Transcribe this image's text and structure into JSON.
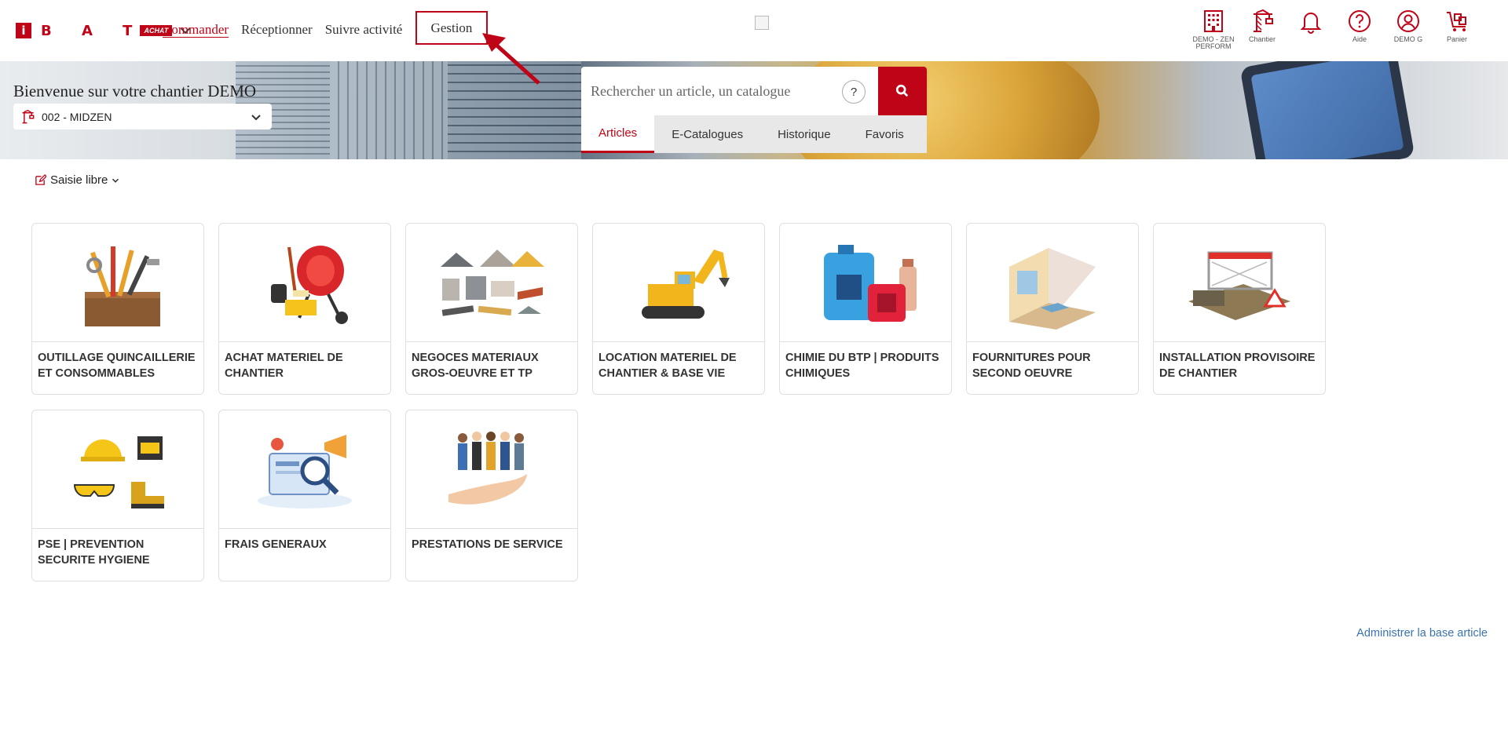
{
  "logo": {
    "letters": "B A T",
    "badge": "ACHAT",
    "i": "i"
  },
  "nav": {
    "items": [
      {
        "label": "Commander",
        "active": true
      },
      {
        "label": "Réceptionner"
      },
      {
        "label": "Suivre activité"
      }
    ],
    "highlighted": {
      "label": "Gestion"
    }
  },
  "header_icons": [
    {
      "icon": "building-icon",
      "label": "DEMO - ZEN PERFORM"
    },
    {
      "icon": "crane-icon",
      "label": "Chantier"
    },
    {
      "icon": "bell-icon",
      "label": ""
    },
    {
      "icon": "help-icon",
      "label": "Aide"
    },
    {
      "icon": "user-icon",
      "label": "DEMO G"
    },
    {
      "icon": "cart-icon",
      "label": "Panier"
    }
  ],
  "hero": {
    "welcome": "Bienvenue sur votre chantier DEMO",
    "chantier_value": "002 - MIDZEN"
  },
  "search": {
    "placeholder": "Rechercher un article, un catalogue",
    "help": "?",
    "tabs": [
      {
        "label": "Articles",
        "active": true
      },
      {
        "label": "E-Catalogues"
      },
      {
        "label": "Historique"
      },
      {
        "label": "Favoris"
      }
    ]
  },
  "saisie": {
    "label": "Saisie libre"
  },
  "categories": [
    {
      "title": "OUTILLAGE QUINCAILLERIE ET CONSOMMABLES",
      "icon": "toolbox-icon"
    },
    {
      "title": "ACHAT MATERIEL DE CHANTIER",
      "icon": "concrete-mixer-icon"
    },
    {
      "title": "NEGOCES MATERIAUX GROS-OEUVRE ET TP",
      "icon": "materials-icon"
    },
    {
      "title": "LOCATION MATERIEL DE CHANTIER & BASE VIE",
      "icon": "excavator-icon"
    },
    {
      "title": "CHIMIE DU BTP | PRODUITS CHIMIQUES",
      "icon": "chemical-cans-icon"
    },
    {
      "title": "FOURNITURES POUR SECOND OEUVRE",
      "icon": "room-renovation-icon"
    },
    {
      "title": "INSTALLATION PROVISOIRE DE CHANTIER",
      "icon": "site-fence-icon"
    },
    {
      "title": "PSE | PREVENTION SECURITE HYGIENE",
      "icon": "safety-equipment-icon"
    },
    {
      "title": "FRAIS GENERAUX",
      "icon": "marketing-icon"
    },
    {
      "title": "PRESTATIONS DE SERVICE",
      "icon": "workers-hand-icon"
    }
  ],
  "admin_link": "Administrer la base article",
  "colors": {
    "brand": "#c00418",
    "link": "#3a73b0"
  }
}
